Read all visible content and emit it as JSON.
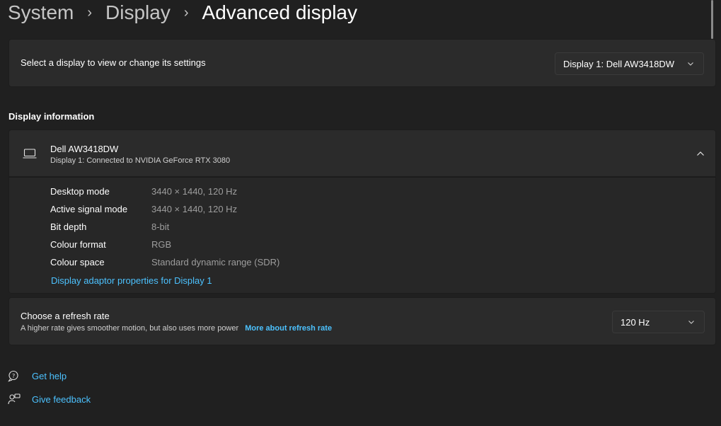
{
  "breadcrumb": {
    "items": [
      "System",
      "Display"
    ],
    "current": "Advanced display",
    "separator": "›"
  },
  "display_select": {
    "label": "Select a display to view or change its settings",
    "selected": "Display 1: Dell AW3418DW"
  },
  "display_info": {
    "section_title": "Display information",
    "name": "Dell AW3418DW",
    "connection": "Display 1: Connected to NVIDIA GeForce RTX 3080",
    "specs": [
      {
        "label": "Desktop mode",
        "value": "3440 × 1440, 120 Hz"
      },
      {
        "label": "Active signal mode",
        "value": "3440 × 1440, 120 Hz"
      },
      {
        "label": "Bit depth",
        "value": "8-bit"
      },
      {
        "label": "Colour format",
        "value": "RGB"
      },
      {
        "label": "Colour space",
        "value": "Standard dynamic range (SDR)"
      }
    ],
    "adapter_link": "Display adaptor properties for Display 1"
  },
  "refresh": {
    "title": "Choose a refresh rate",
    "description": "A higher rate gives smoother motion, but also uses more power",
    "more_link": "More about refresh rate",
    "selected": "120 Hz"
  },
  "footer": {
    "help": "Get help",
    "feedback": "Give feedback"
  },
  "colors": {
    "background": "#202020",
    "card": "#2b2b2b",
    "accent_link": "#4cc2ff",
    "muted_text": "#9d9d9d"
  },
  "icons": {
    "monitor": "monitor-icon",
    "chevron_down": "chevron-down-icon",
    "chevron_up": "chevron-up-icon",
    "help": "help-icon",
    "feedback": "feedback-icon"
  }
}
